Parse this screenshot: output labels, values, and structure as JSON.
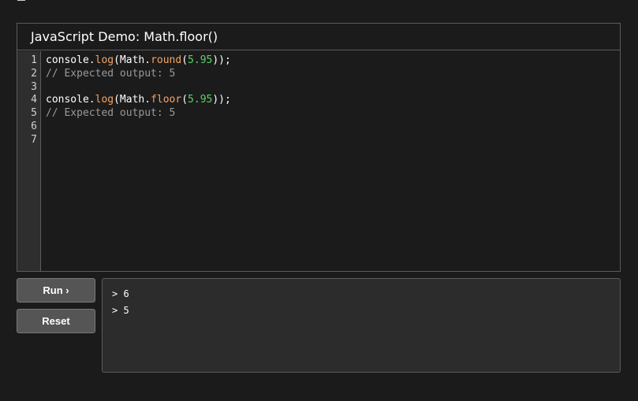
{
  "demo": {
    "title": "JavaScript Demo: Math.floor()"
  },
  "editor": {
    "line_numbers": [
      "1",
      "2",
      "3",
      "4",
      "5",
      "6",
      "7"
    ],
    "lines": [
      [
        {
          "text": "console.",
          "cls": "t-plain"
        },
        {
          "text": "log",
          "cls": "t-fn"
        },
        {
          "text": "(Math.",
          "cls": "t-plain"
        },
        {
          "text": "round",
          "cls": "t-fn"
        },
        {
          "text": "(",
          "cls": "t-plain"
        },
        {
          "text": "5.95",
          "cls": "t-num"
        },
        {
          "text": "));",
          "cls": "t-plain"
        }
      ],
      [
        {
          "text": "// Expected output: 5",
          "cls": "t-comment"
        }
      ],
      [],
      [
        {
          "text": "console.",
          "cls": "t-plain"
        },
        {
          "text": "log",
          "cls": "t-fn"
        },
        {
          "text": "(Math.",
          "cls": "t-plain"
        },
        {
          "text": "floor",
          "cls": "t-fn"
        },
        {
          "text": "(",
          "cls": "t-plain"
        },
        {
          "text": "5.95",
          "cls": "t-num"
        },
        {
          "text": "));",
          "cls": "t-plain"
        }
      ],
      [
        {
          "text": "// Expected output: 5",
          "cls": "t-comment"
        }
      ],
      [],
      []
    ]
  },
  "buttons": {
    "run_label": "Run ›",
    "reset_label": "Reset"
  },
  "console": {
    "lines": [
      "> 6",
      "> 5"
    ]
  },
  "colors": {
    "background": "#1b1b1b",
    "keyword_function": "#f3a56a",
    "number": "#5fd06b",
    "comment": "#9a9a9a"
  }
}
